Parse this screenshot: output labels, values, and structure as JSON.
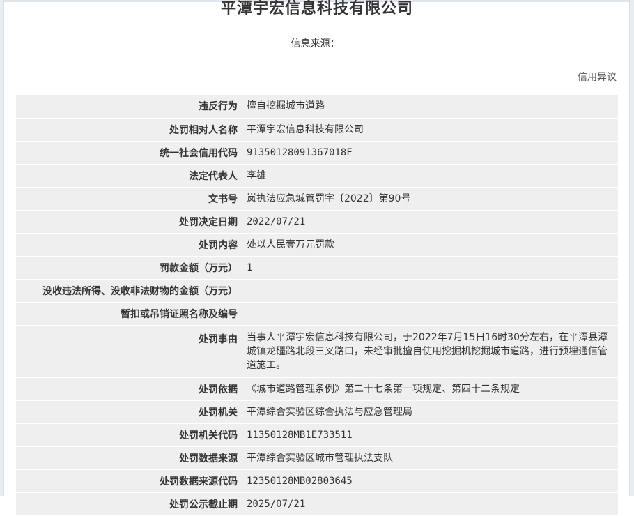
{
  "page": {
    "title": "平潭宇宏信息科技有限公司",
    "source_label": "信息来源：",
    "objection_link": "信用异议"
  },
  "rows": [
    {
      "label": "违反行为",
      "value": "擅自挖掘城市道路"
    },
    {
      "label": "处罚相对人名称",
      "value": "平潭宇宏信息科技有限公司"
    },
    {
      "label": "统一社会信用代码",
      "value": "91350128091367018F"
    },
    {
      "label": "法定代表人",
      "value": "李雄"
    },
    {
      "label": "文书号",
      "value": "岚执法应急城管罚字〔2022〕第90号"
    },
    {
      "label": "处罚决定日期",
      "value": "2022/07/21"
    },
    {
      "label": "处罚内容",
      "value": "处以人民壹万元罚款"
    },
    {
      "label": "罚款金额（万元）",
      "value": "1"
    },
    {
      "label": "没收违法所得、没收非法财物的金额（万元）",
      "value": ""
    },
    {
      "label": "暂扣或吊销证照名称及编号",
      "value": ""
    },
    {
      "label": "处罚事由",
      "value": "当事人平潭宇宏信息科技有限公司，于2022年7月15日16时30分左右，在平潭县潭城镇龙礓路北段三叉路口，未经审批擅自使用挖掘机挖掘城市道路，进行预埋通信管道施工。"
    },
    {
      "label": "处罚依据",
      "value": "《城市道路管理条例》第二十七条第一项规定、第四十二条规定"
    },
    {
      "label": "处罚机关",
      "value": "平潭综合实验区综合执法与应急管理局"
    },
    {
      "label": "处罚机关代码",
      "value": "11350128MB1E733511"
    },
    {
      "label": "处罚数据来源",
      "value": "平潭综合实验区城市管理执法支队"
    },
    {
      "label": "处罚数据来源代码",
      "value": "12350128MB02803645"
    },
    {
      "label": "处罚公示截止期",
      "value": "2025/07/21"
    }
  ]
}
